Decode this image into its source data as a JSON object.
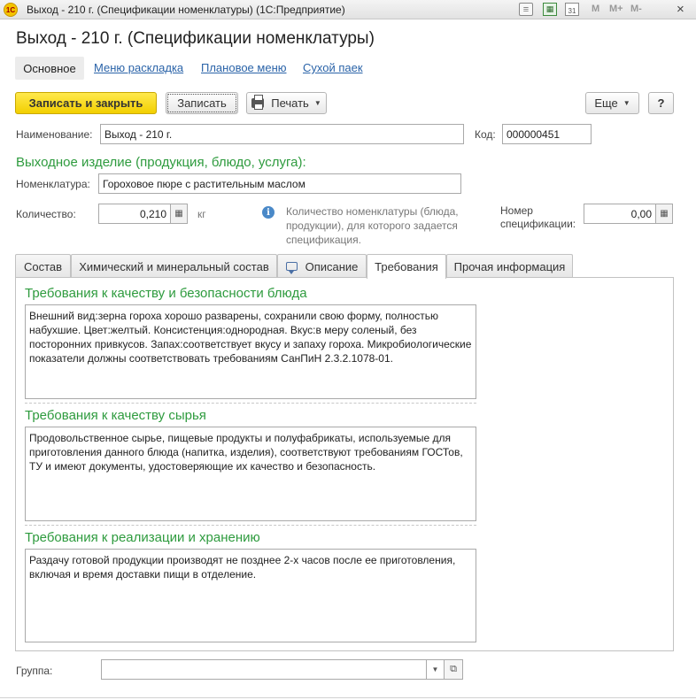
{
  "window": {
    "title": "Выход - 210 г. (Спецификации номенклатуры)  (1С:Предприятие)",
    "app_logo": "1С",
    "tools": {
      "m": "M",
      "mplus": "M+",
      "mminus": "M-",
      "calendar_day": "31",
      "calc": "▦"
    },
    "close": "×"
  },
  "form": {
    "title": "Выход - 210 г. (Спецификации номенклатуры)",
    "nav": {
      "main": "Основное",
      "menu_layout": "Меню раскладка",
      "plan_menu": "Плановое меню",
      "dry_ration": "Сухой паек"
    }
  },
  "toolbar": {
    "save_close": "Записать и закрыть",
    "save": "Записать",
    "print": "Печать",
    "more": "Еще",
    "help": "?"
  },
  "fields": {
    "name_label": "Наименование:",
    "name_value": "Выход - 210 г.",
    "code_label": "Код:",
    "code_value": "000000451",
    "output_title": "Выходное изделие (продукция, блюдо, услуга):",
    "nomenclature_label": "Номенклатура:",
    "nomenclature_value": "Гороховое пюре с растительным маслом",
    "quantity_label": "Количество:",
    "quantity_value": "0,210",
    "unit": "кг",
    "info_text": "Количество номенклатуры (блюда, продукции), для которого задается спецификация.",
    "spec_number_label": "Номер спецификации:",
    "spec_number_value": "0,00",
    "group_label": "Группа:",
    "group_value": ""
  },
  "tabs": {
    "composition": "Состав",
    "chemical": "Химический и минеральный состав",
    "description": "Описание",
    "requirements": "Требования",
    "other": "Прочая информация"
  },
  "requirements": {
    "quality_safety_title": "Требования к качеству и безопасности блюда",
    "quality_safety_text": "Внешний вид:зерна гороха хорошо разварены, сохранили свою форму, полностью набухшие.  Цвет:желтый. Консистенция:однородная. Вкус:в меру соленый, без посторонних привкусов. Запах:соответствует вкусу и запаху гороха. Микробиологические показатели должны соответствовать требованиям СанПиН 2.3.2.1078-01.",
    "raw_quality_title": "Требования к качеству сырья",
    "raw_quality_text": "Продовольственное сырье, пищевые продукты и полуфабрикаты, используемые для приготовления данного блюда (напитка, изделия), соответствуют требованиям ГОСТов, ТУ и имеют документы, удостоверяющие их качество и безопасность.",
    "storage_title": "Требования к реализации и хранению",
    "storage_text": "Раздачу готовой продукции производят не позднее 2-х часов после ее приготовления, включая и время доставки пищи в отделение."
  },
  "icons": {
    "calculator": "▦",
    "info": "i",
    "dropdown": "▼",
    "open": "⧉"
  }
}
